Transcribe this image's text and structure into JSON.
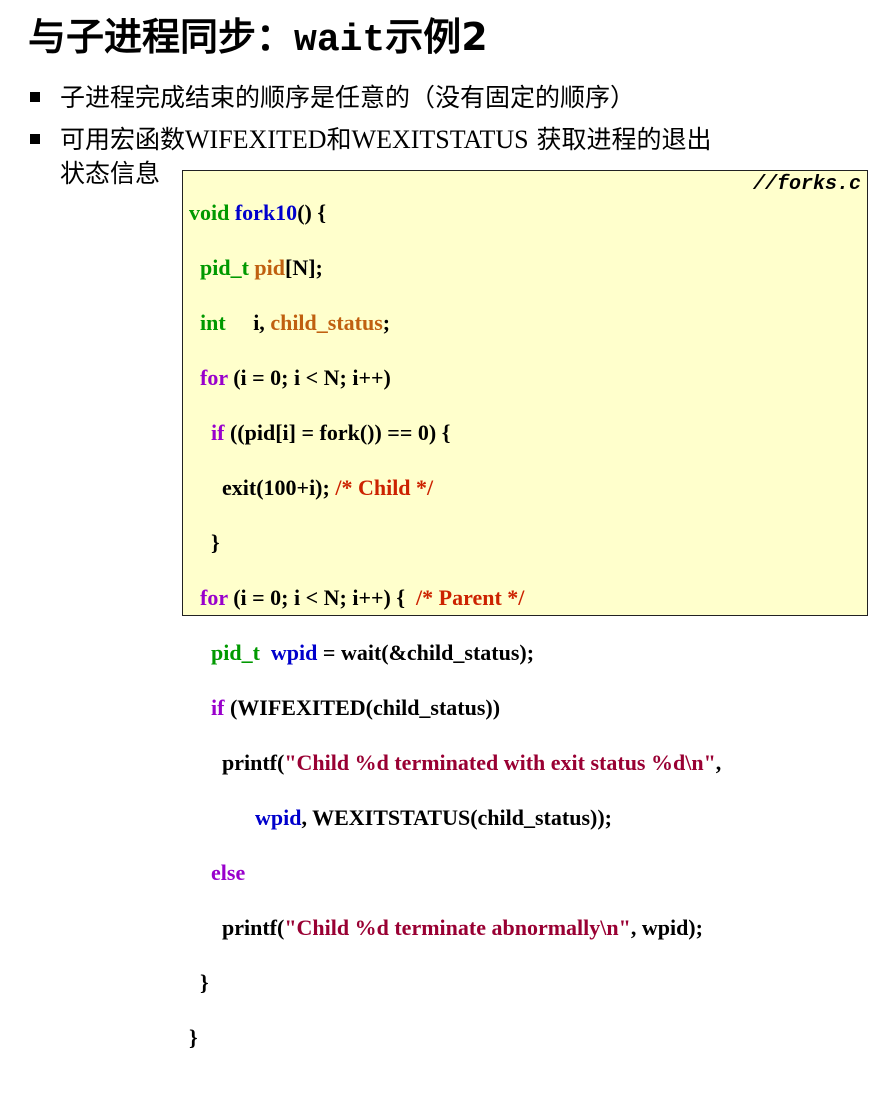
{
  "title": {
    "cn": "与子进程同步：",
    "mono": "wait",
    "suffix": "示例2"
  },
  "bullets": {
    "b1": "子进程完成结束的顺序是任意的（没有固定的顺序）",
    "b2_a": "可用宏函数",
    "b2_b": "WIFEXITED",
    "b2_c": "和",
    "b2_d": "WEXITSTATUS",
    "b2_e": " 获取进程的退出",
    "b2_f": "状态信息"
  },
  "code": {
    "filename": "//forks.c",
    "l1": {
      "a": "void",
      "b": " ",
      "c": "fork10",
      "d": "() {"
    },
    "l2": {
      "indent": "  ",
      "a": "pid_t",
      "b": " ",
      "c": "pid",
      "d": "[N];"
    },
    "l3": {
      "indent": "  ",
      "a": "int",
      "b": "     i, ",
      "c": "child_status",
      "d": ";"
    },
    "l4": {
      "indent": "  ",
      "a": "for",
      "b": " (i = 0; i < N; i++)"
    },
    "l5": {
      "indent": "    ",
      "a": "if",
      "b": " ((pid[i] = fork()) == 0) {"
    },
    "l6": {
      "indent": "      ",
      "a": "exit(100+i); ",
      "b": "/* Child */"
    },
    "l7": {
      "indent": "    ",
      "a": "}"
    },
    "l8": {
      "indent": "  ",
      "a": "for",
      "b": " (i = 0; i < N; i++) {  ",
      "c": "/* Parent */"
    },
    "l9": {
      "indent": "    ",
      "a": "pid_t",
      "b": "  ",
      "c": "wpid",
      "d": " = wait(&child_status);"
    },
    "l10": {
      "indent": "    ",
      "a": "if",
      "b": " (WIFEXITED(child_status))"
    },
    "l11": {
      "indent": "      ",
      "a": "printf(",
      "b": "\"Child %d terminated with exit status %d\\n\"",
      "c": ","
    },
    "l12": {
      "indent": "            ",
      "a": "wpid",
      "b": ", WEXITSTATUS(child_status));"
    },
    "l13": {
      "indent": "    ",
      "a": "else"
    },
    "l14": {
      "indent": "      ",
      "a": "printf(",
      "b": "\"Child %d terminate abnormally\\n\"",
      "c": ", wpid);"
    },
    "l15": {
      "indent": "  ",
      "a": "}"
    },
    "l16": {
      "a": "}"
    }
  },
  "colors": {
    "keyword": "#9900cc",
    "type": "#009900",
    "function": "#0000cc",
    "identifier": "#c06010",
    "comment": "#cc2200",
    "string": "#990033",
    "code_background": "#ffffcc"
  }
}
